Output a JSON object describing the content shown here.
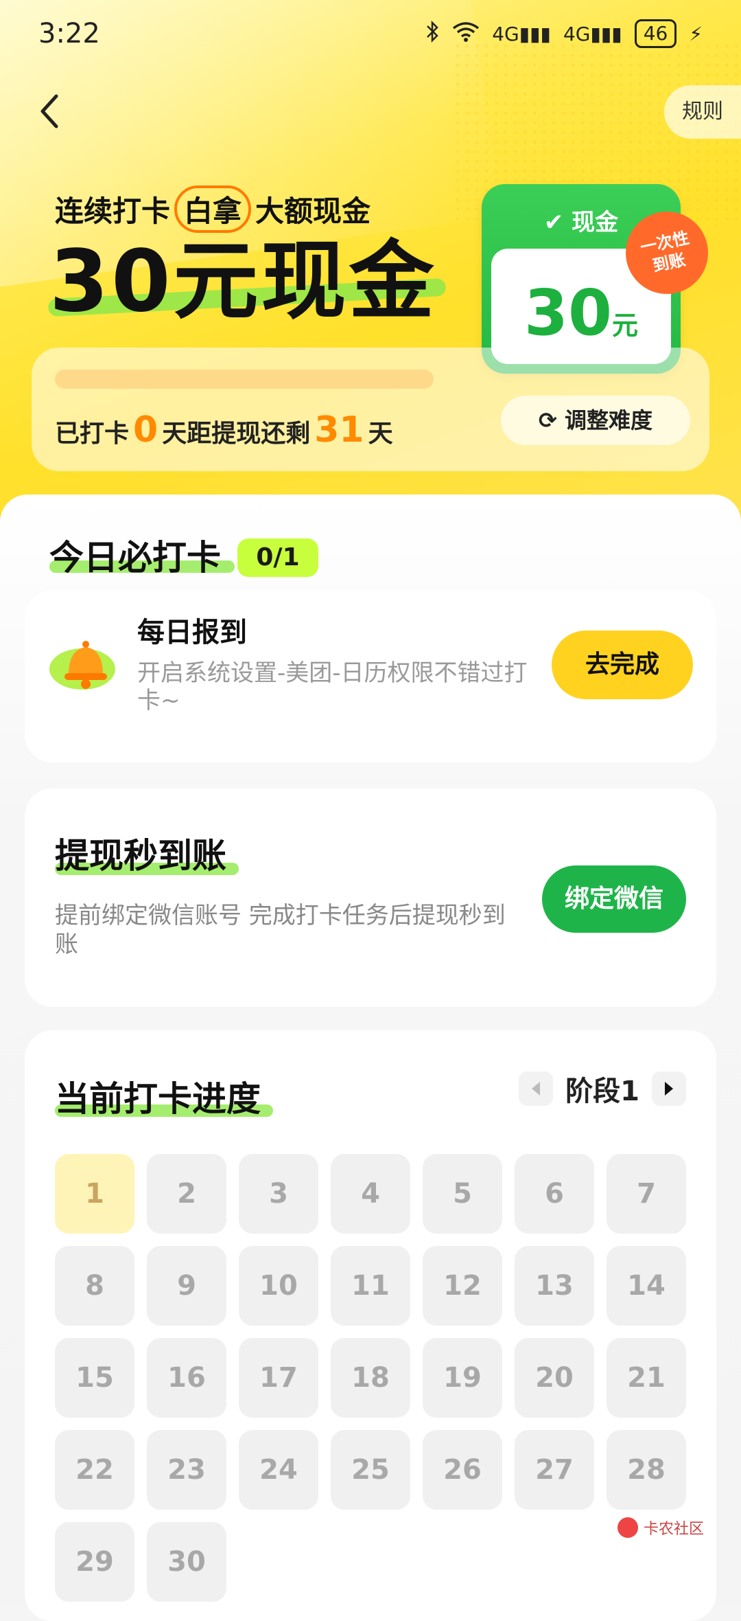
{
  "status_bar": {
    "time": "3:22",
    "signal1": "4G",
    "signal2": "4G",
    "battery": "46"
  },
  "header": {
    "rules_label": "规则"
  },
  "hero": {
    "subtitle_pre": "连续打卡",
    "subtitle_circle": "白拿",
    "subtitle_post": "大额现金",
    "title": "30元现金",
    "cash_label": "现金",
    "cash_amount": "30",
    "cash_unit": "元",
    "badge_line1": "一次性",
    "badge_line2": "到账",
    "progress_prefix": "已打卡",
    "checked_days": "0",
    "progress_mid": "天距提现还剩",
    "remaining_days": "31",
    "progress_suffix": "天",
    "progress_fraction": 0,
    "adjust_label": "调整难度"
  },
  "today": {
    "title": "今日必打卡",
    "count": "0/1",
    "task_name": "每日报到",
    "task_desc": "开启系统设置-美团-日历权限不错过打卡~",
    "task_button": "去完成"
  },
  "withdraw": {
    "title": "提现秒到账",
    "desc": "提前绑定微信账号 完成打卡任务后提现秒到账",
    "button": "绑定微信"
  },
  "progress": {
    "title": "当前打卡进度",
    "stage": "阶段1",
    "days": [
      "1",
      "2",
      "3",
      "4",
      "5",
      "6",
      "7",
      "8",
      "9",
      "10",
      "11",
      "12",
      "13",
      "14",
      "15",
      "16",
      "17",
      "18",
      "19",
      "20",
      "21",
      "22",
      "23",
      "24",
      "25",
      "26",
      "27",
      "28",
      "29",
      "30"
    ],
    "current_day": "1"
  },
  "watermark": {
    "text": "卡农社区"
  },
  "colors": {
    "accent_yellow": "#ffd21f",
    "accent_green": "#1fb44a",
    "accent_orange": "#ff8a00"
  }
}
